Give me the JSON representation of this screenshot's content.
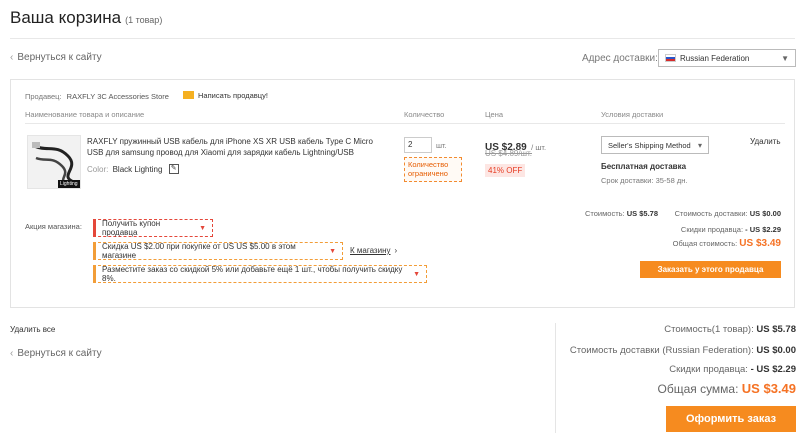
{
  "header": {
    "title": "Ваша корзина",
    "count": "(1 товар)"
  },
  "nav": {
    "back_top": "Вернуться к сайту",
    "back_bottom": "Вернуться к сайту"
  },
  "delivery": {
    "label": "Адрес доставки:",
    "country": "Russian Federation"
  },
  "seller": {
    "label": "Продавец:",
    "name": "RAXFLY 3C Accessories Store",
    "contact": "Написать продавцу!"
  },
  "columns": {
    "name": "Наименование товара и описание",
    "qty": "Количество",
    "price": "Цена",
    "shipping": "Условия доставки"
  },
  "item": {
    "title_line1": "RAXFLY пружинный USB кабель для iPhone XS XR USB кабель Type C Micro",
    "title_line2": "USB для samsung провод для Xiaomi для зарядки кабель Lightning/USB",
    "color_label": "Color:",
    "color_value": "Black Lighting",
    "thumb_label": "Lighting",
    "qty": "2",
    "qty_unit": "шт.",
    "limited_line1": "Количество",
    "limited_line2": "ограничено",
    "price": "US $2.89",
    "price_unit": "/ шт.",
    "old_price": "US $4.89/шт.",
    "discount": "41% OFF",
    "shipping_method": "Seller's Shipping Method",
    "free_shipping": "Бесплатная доставка",
    "delivery_time": "Срок доставки: 35-58 дн.",
    "delete": "Удалить"
  },
  "store_promo": {
    "label": "Акция магазина:",
    "coupon": "Получить купон продавца",
    "discount_offer": "Скидка US $2.00 при покупке от US US $5.00 в этом магазине",
    "to_store": "К магазину",
    "bulk_offer": "Разместите заказ со скидкой 5% или добавьте ещё 1 шт., чтобы получить скидку 8%."
  },
  "seller_summary": {
    "cost_label": "Стоимость:",
    "cost_value": "US $5.78",
    "shipping_label": "Стоимость доставки:",
    "shipping_value": "US $0.00",
    "discount_label": "Скидки продавца:",
    "discount_value": "- US $2.29",
    "total_label": "Общая стоимость:",
    "total_value": "US $3.49",
    "button": "Заказать у этого продавца"
  },
  "bottom": {
    "delete_all": "Удалить все",
    "items_label": "Стоимость(1 товар):",
    "items_value": "US $5.78",
    "shipping_label": "Стоимость доставки (Russian Federation):",
    "shipping_value": "US $0.00",
    "discount_label": "Скидки продавца:",
    "discount_value": "- US $2.29",
    "total_label": "Общая сумма:",
    "total_value": "US $3.49",
    "checkout": "Оформить заказ"
  },
  "colors": {
    "accent": "#f68b1f",
    "price_red": "#f57224",
    "promo_red": "#e4473a"
  }
}
